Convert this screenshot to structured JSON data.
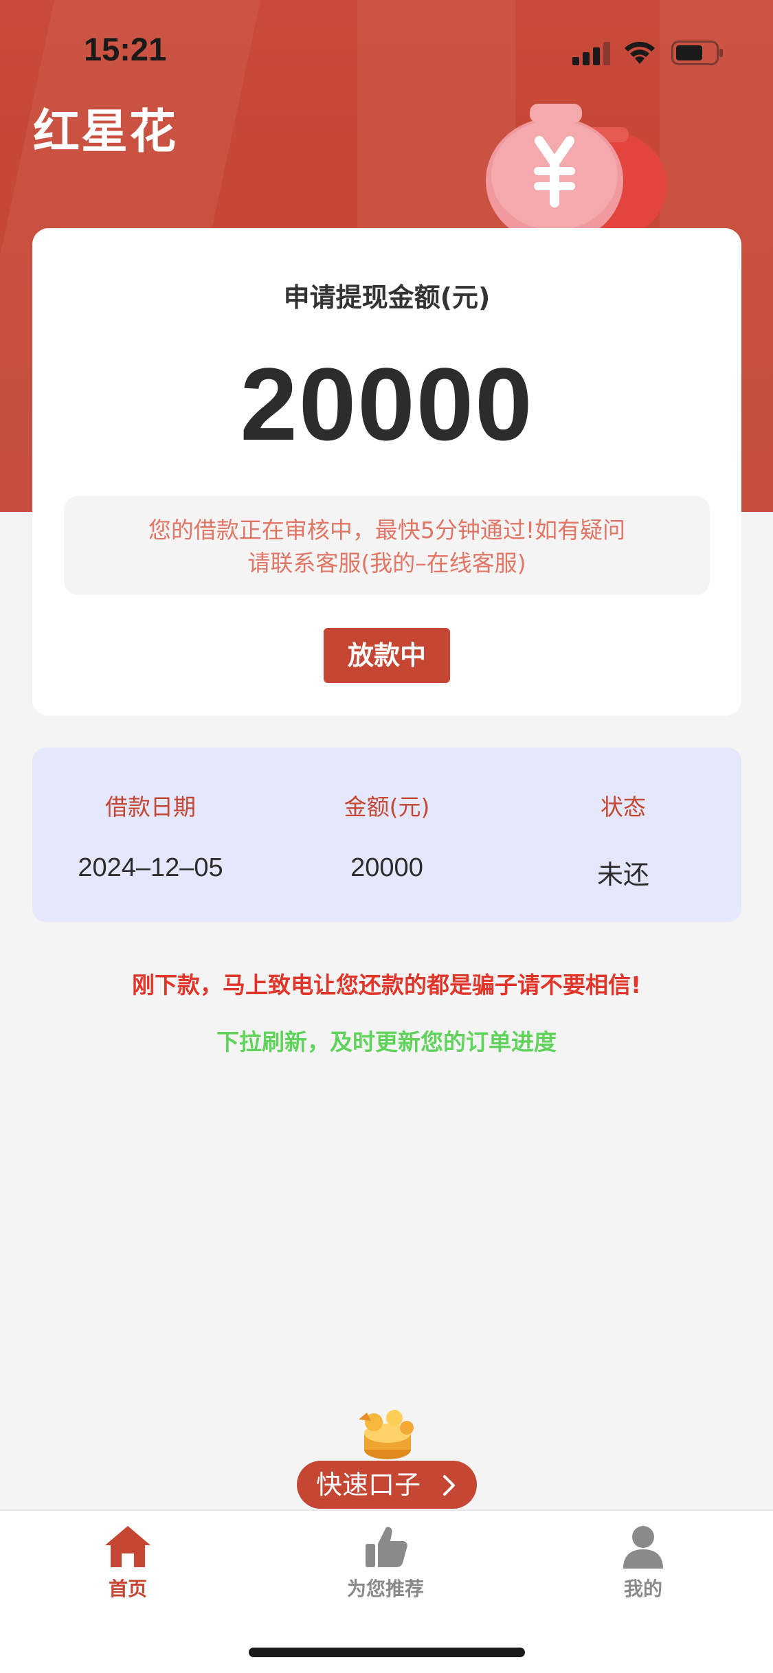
{
  "status_bar": {
    "time": "15:21"
  },
  "app": {
    "title": "红星花"
  },
  "apply_card": {
    "label": "申请提现金额(元)",
    "amount": "20000",
    "notice_line1": "您的借款正在审核中，最快5分钟通过!如有疑问",
    "notice_line2": "请联系客服(我的–在线客服)",
    "status_button": "放款中"
  },
  "loan_table": {
    "headers": [
      "借款日期",
      "金额(元)",
      "状态"
    ],
    "row": [
      "2024–12–05",
      "20000",
      "未还"
    ]
  },
  "warning": "刚下款，马上致电让您还款的都是骗子请不要相信!",
  "refresh_hint": "下拉刷新，及时更新您的订单进度",
  "quick_entry": {
    "label": "快速口子"
  },
  "tabs": [
    {
      "label": "首页",
      "icon": "home-icon",
      "active": true
    },
    {
      "label": "为您推荐",
      "icon": "thumbs-up-icon",
      "active": false
    },
    {
      "label": "我的",
      "icon": "user-icon",
      "active": false
    }
  ],
  "colors": {
    "brand": "#c44633",
    "notice_text": "#e17666",
    "warning": "#e2352a",
    "hint": "#5fd35a",
    "table_bg": "#e5e8fc",
    "tab_inactive": "#8a8a8a"
  }
}
